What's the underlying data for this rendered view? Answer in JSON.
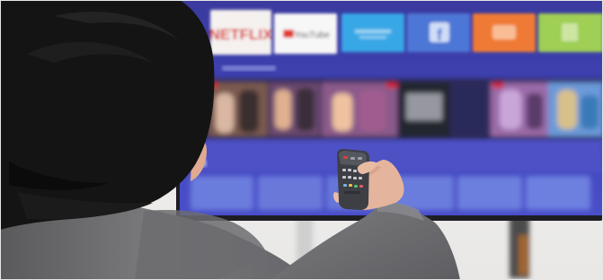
{
  "photo": {
    "subject": "person-pointing-remote-at-smart-tv",
    "tv": {
      "app_tiles": [
        {
          "name": "netflix-tile",
          "label": "NETFLIX",
          "bg": "#f4f1ee",
          "fg": "#d81f26"
        },
        {
          "name": "youtube-tile",
          "label": "YouTube",
          "bg": "#f7f7f7",
          "fg": "#e23b2f"
        },
        {
          "name": "blue-app-tile",
          "label": "",
          "bg": "#39a7e6",
          "fg": "#dff1fb"
        },
        {
          "name": "facebook-tile",
          "label": "f",
          "bg": "#4d77d6",
          "fg": "#e8eefb"
        },
        {
          "name": "orange-app-tile",
          "label": "",
          "bg": "#ef7a34",
          "fg": "#ffe9d8"
        },
        {
          "name": "green-app-tile",
          "label": "",
          "bg": "#9fcf55",
          "fg": "#f0f8e3"
        }
      ],
      "screen_bg": "#3b3fb0",
      "row_bar_color": "#4a4fc4"
    },
    "colors": {
      "hair": "#141414",
      "sweater": "#6f6f72",
      "skin": "#e7b9a2",
      "remote": "#3d3f45",
      "wall": "#f4f4f3"
    }
  }
}
